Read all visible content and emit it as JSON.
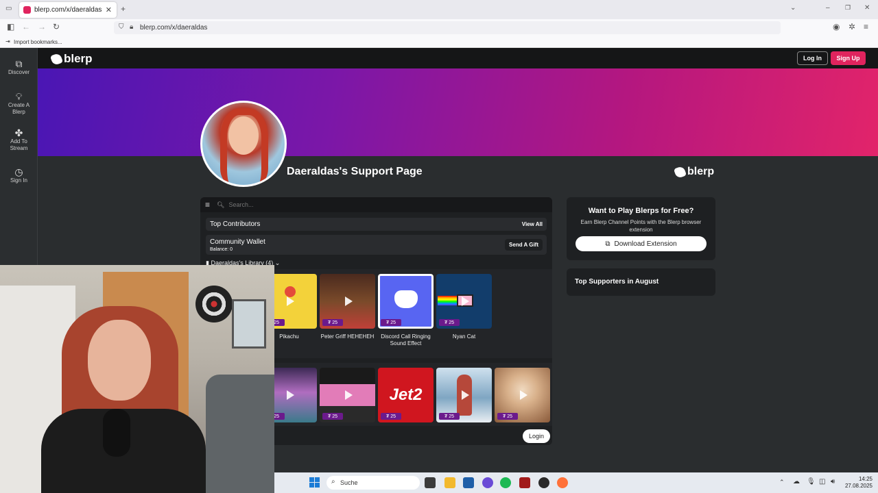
{
  "browser": {
    "tab_title": "blerp.com/x/daeraldas",
    "url": "blerp.com/x/daeraldas",
    "bookmark": "Import bookmarks..."
  },
  "sidebar": {
    "items": [
      {
        "label": "Discover"
      },
      {
        "label": "Create A Blerp"
      },
      {
        "label": "Add To Stream"
      },
      {
        "label": "Sign In"
      }
    ]
  },
  "header": {
    "logo": "blerp",
    "login": "Log In",
    "signup": "Sign Up"
  },
  "profile": {
    "title": "Daeraldas's Support Page",
    "logo": "blerp"
  },
  "panel": {
    "search_placeholder": "Search...",
    "top_contributors": "Top Contributors",
    "view_all": "View All",
    "wallet_title": "Community Wallet",
    "wallet_balance": "Balance: 0",
    "send_gift": "Send A Gift",
    "library": "Daeraldas's Library (4)",
    "login": "Login",
    "row1": [
      {
        "label": "Pikachu",
        "price": "25",
        "color": "#f3d23a"
      },
      {
        "label": "Peter Griff HEHEHEH",
        "price": "25",
        "color": "#6a4a3a"
      },
      {
        "label": "Discord Call Ringing Sound Effect",
        "price": "25",
        "color": "#5865f2"
      },
      {
        "label": "Nyan Cat",
        "price": "25",
        "color": "#123d6b"
      }
    ],
    "row2": [
      {
        "price": "25",
        "color": "#7a4c86"
      },
      {
        "price": "25",
        "color": "#2a2a2a"
      },
      {
        "price": "25",
        "color": "#d0161f",
        "text": "Jet2"
      },
      {
        "price": "25",
        "color": "#7fa6c3"
      },
      {
        "price": "25",
        "color": "#b9895e"
      }
    ]
  },
  "cards": {
    "play_title": "Want to Play Blerps for Free?",
    "play_desc": "Earn Blerp Channel Points with the Blerp browser extension",
    "download": "Download Extension",
    "supporters": "Top Supporters in August"
  },
  "taskbar": {
    "search": "Suche",
    "time": "14:25",
    "date": "27.08.2025"
  }
}
